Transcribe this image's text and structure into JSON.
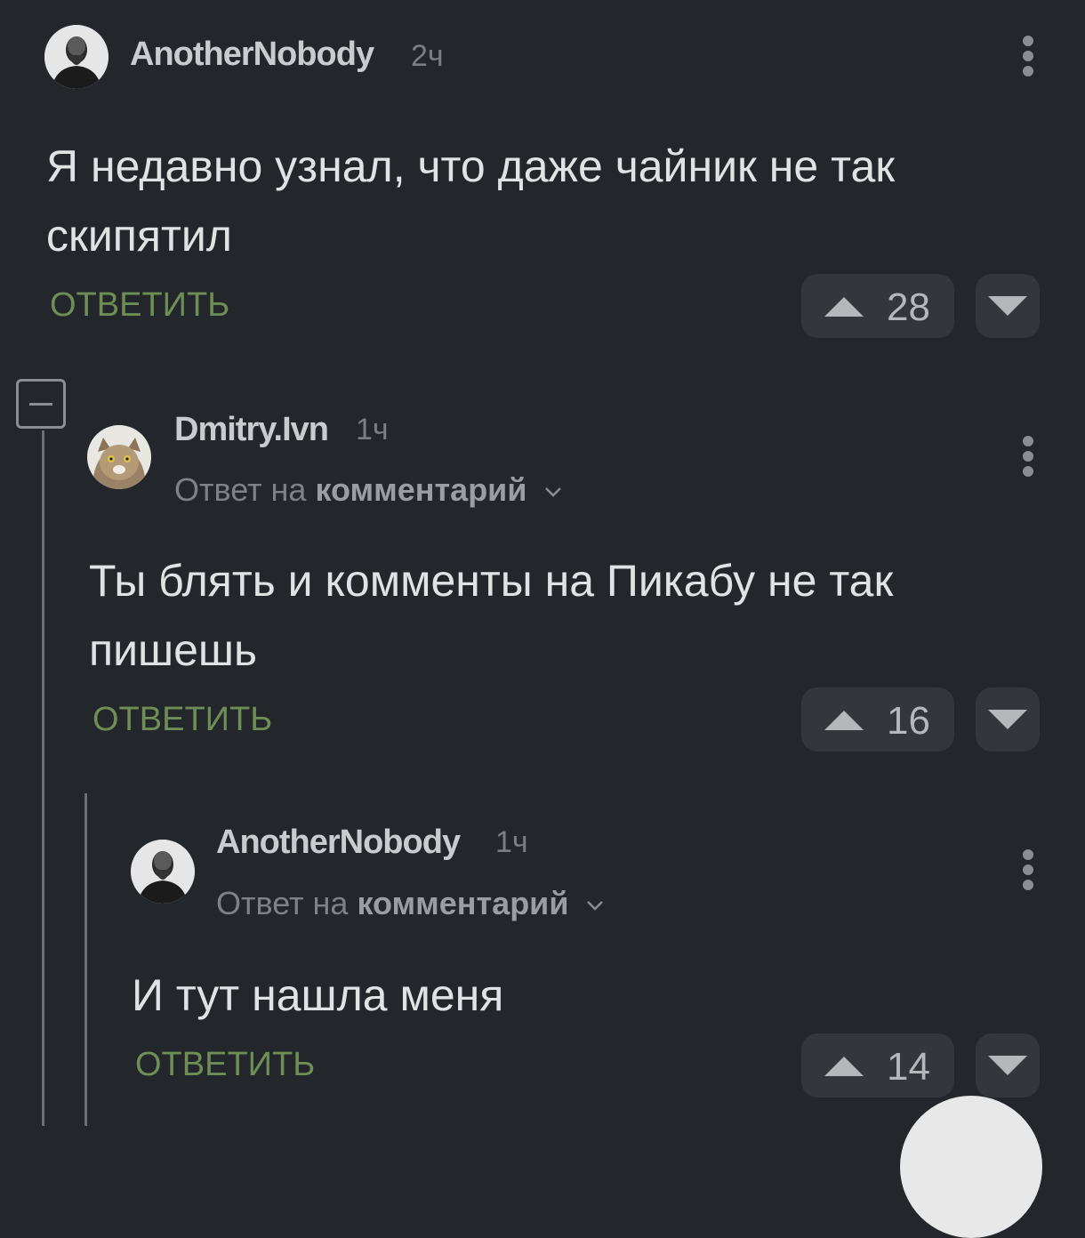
{
  "comments": [
    {
      "author": "AnotherNobody",
      "time": "2ч",
      "text": "Я недавно узнал, что даже чайник не так скипятил",
      "reply_label": "ОТВЕТИТЬ",
      "score": "28",
      "avatar_icon": "bald-man-avatar"
    },
    {
      "author": "Dmitry.Ivn",
      "time": "1ч",
      "reply_to_prefix": "Ответ на",
      "reply_to_link": "комментарий",
      "text": "Ты блять и комменты на Пикабу не так пишешь",
      "reply_label": "ОТВЕТИТЬ",
      "score": "16",
      "avatar_icon": "cat-avatar"
    },
    {
      "author": "AnotherNobody",
      "time": "1ч",
      "reply_to_prefix": "Ответ на",
      "reply_to_link": "комментарий",
      "text": "И тут нашла меня",
      "reply_label": "ОТВЕТИТЬ",
      "score": "14",
      "avatar_icon": "bald-man-avatar"
    }
  ],
  "colors": {
    "background": "#23262b",
    "reply_green": "#6d8e55",
    "vote_bg": "#33363b"
  }
}
